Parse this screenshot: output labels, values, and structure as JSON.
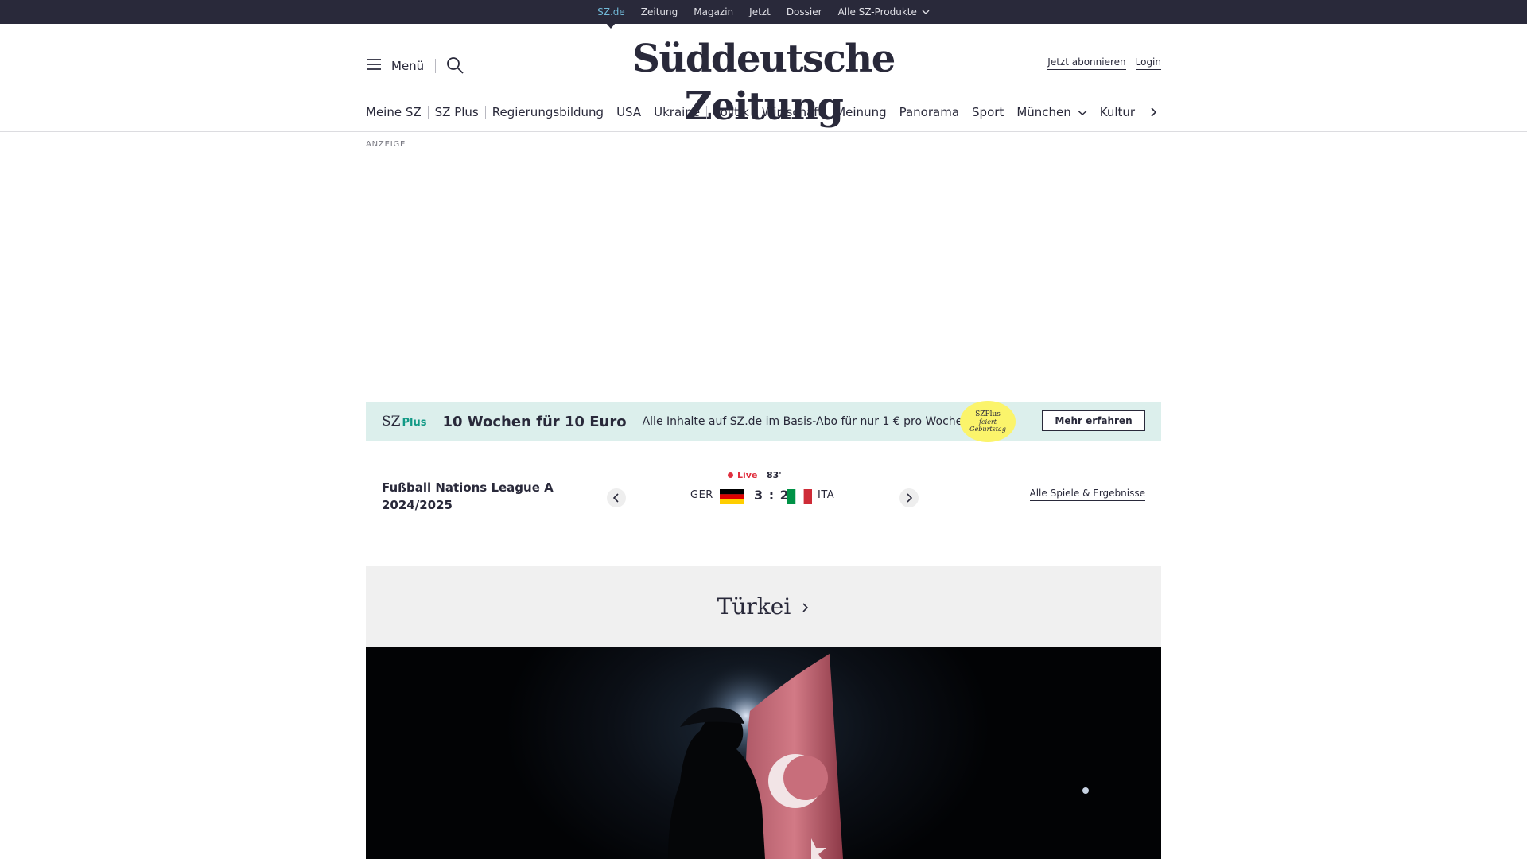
{
  "topbar": {
    "items": [
      "SZ.de",
      "Zeitung",
      "Magazin",
      "Jetzt",
      "Dossier",
      "Alle SZ-Produkte"
    ]
  },
  "header": {
    "menu_label": "Menü",
    "logo": "Süddeutsche Zeitung",
    "subscribe_label": "Jetzt abonnieren",
    "login_label": "Login"
  },
  "mainnav": {
    "items": [
      "Meine SZ",
      "SZ Plus",
      "Regierungsbildung",
      "USA",
      "Ukraine",
      "Politik",
      "Wirtschaft",
      "Meinung",
      "Panorama",
      "Sport",
      "München",
      "Kultur"
    ]
  },
  "ad": {
    "label": "ANZEIGE"
  },
  "promo": {
    "brand": "SZ",
    "brand_plus": "Plus",
    "headline": "10 Wochen für 10 Euro",
    "text": "Alle Inhalte auf SZ.de im Basis-Abo für nur 1 € pro Woche.",
    "badge_line1": "SZPlus",
    "badge_line2": "feiert",
    "badge_line3": "Geburtstag",
    "cta_label": "Mehr erfahren"
  },
  "score": {
    "competition": "Fußball Nations League A 2024/2025",
    "live_label": "Live",
    "minute": "83'",
    "home_team": "GER",
    "away_team": "ITA",
    "result": "3 : 2",
    "all_games_label": "Alle Spiele & Ergebnisse"
  },
  "topic": {
    "title": "Türkei"
  },
  "colors": {
    "topbar_bg": "#29293a",
    "active_link": "#71b9d8",
    "promo_bg": "#dcefec",
    "plus_green": "#129a86",
    "badge_yellow": "#fbf46b",
    "live_red": "#e0303f",
    "topic_bg": "#f0f0f0"
  }
}
